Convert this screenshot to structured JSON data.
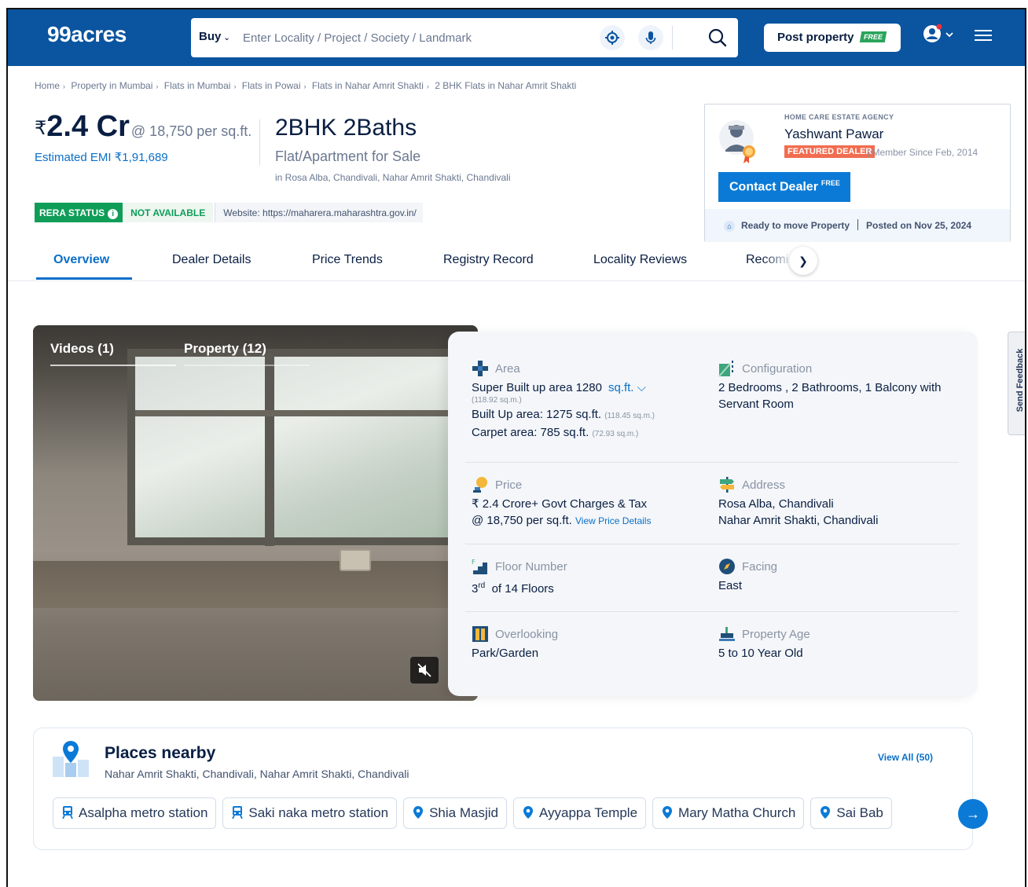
{
  "header": {
    "logo": "99acres",
    "buy_label": "Buy",
    "search_placeholder": "Enter Locality / Project / Society / Landmark",
    "post_property_label": "Post property",
    "post_property_tag": "FREE"
  },
  "breadcrumb": [
    "Home",
    "Property in Mumbai",
    "Flats in Mumbai",
    "Flats in Powai",
    "Flats in Nahar Amrit Shakti",
    "2 BHK Flats in Nahar Amrit Shakti"
  ],
  "listing": {
    "currency": "₹",
    "price": "2.4 Cr",
    "price_per_sqft": "@ 18,750 per sq.ft.",
    "emi": "Estimated EMI ₹1,91,689",
    "title": "2BHK 2Baths",
    "type": "Flat/Apartment for Sale",
    "location": "in Rosa Alba, Chandivali, Nahar Amrit Shakti, Chandivali",
    "rera_label": "RERA STATUS",
    "rera_value": "NOT AVAILABLE",
    "rera_website": "Website: https://maharera.maharashtra.gov.in/"
  },
  "dealer": {
    "agency": "HOME CARE ESTATE AGENCY",
    "name": "Yashwant Pawar",
    "badge": "FEATURED DEALER",
    "member_since": "| Member Since Feb, 2014",
    "contact_label": "Contact Dealer",
    "contact_tag": "FREE",
    "status": "Ready to move Property",
    "posted": "Posted on Nov 25, 2024"
  },
  "tabs": [
    "Overview",
    "Dealer Details",
    "Price Trends",
    "Registry Record",
    "Locality Reviews",
    "Recomi"
  ],
  "media": {
    "tabs": [
      "Videos (1)",
      "Property (12)"
    ]
  },
  "details": {
    "area": {
      "label": "Area",
      "super_built": "Super Built up area 1280",
      "unit": "sq.ft.",
      "super_built_sqm": "(118.92 sq.m.)",
      "built_up": "Built Up area: 1275 sq.ft.",
      "built_up_sqm": "(118.45 sq.m.)",
      "carpet": "Carpet area: 785 sq.ft.",
      "carpet_sqm": "(72.93 sq.m.)"
    },
    "configuration": {
      "label": "Configuration",
      "value": "2 Bedrooms , 2 Bathrooms, 1 Balcony with Servant Room"
    },
    "price": {
      "label": "Price",
      "line1": "₹ 2.4 Crore+ Govt Charges & Tax",
      "line2": "@ 18,750 per sq.ft.",
      "link": "View Price Details"
    },
    "address": {
      "label": "Address",
      "line1": "Rosa Alba, Chandivali",
      "line2": "Nahar Amrit Shakti, Chandivali"
    },
    "floor": {
      "label": "Floor Number",
      "floor": "3",
      "suffix": "rd",
      "of": "of 14 Floors"
    },
    "facing": {
      "label": "Facing",
      "value": "East"
    },
    "overlooking": {
      "label": "Overlooking",
      "value": "Park/Garden"
    },
    "age": {
      "label": "Property Age",
      "value": "5 to 10 Year Old"
    }
  },
  "feedback_label": "Send Feedback",
  "places": {
    "title": "Places nearby",
    "subtitle": "Nahar Amrit Shakti, Chandivali, Nahar Amrit Shakti, Chandivali",
    "view_all": "View All (50)",
    "items": [
      {
        "name": "Asalpha metro station",
        "icon": "metro-icon"
      },
      {
        "name": "Saki naka metro station",
        "icon": "metro-icon"
      },
      {
        "name": "Shia Masjid",
        "icon": "pin-icon"
      },
      {
        "name": "Ayyappa Temple",
        "icon": "pin-icon"
      },
      {
        "name": "Mary Matha Church",
        "icon": "pin-icon"
      },
      {
        "name": "Sai Bab",
        "icon": "pin-icon"
      }
    ]
  },
  "colors": {
    "brand_blue": "#0a54a0",
    "link_blue": "#0a6fc9",
    "rera_green": "#0f9d58",
    "featured_orange": "#f26c4f"
  }
}
